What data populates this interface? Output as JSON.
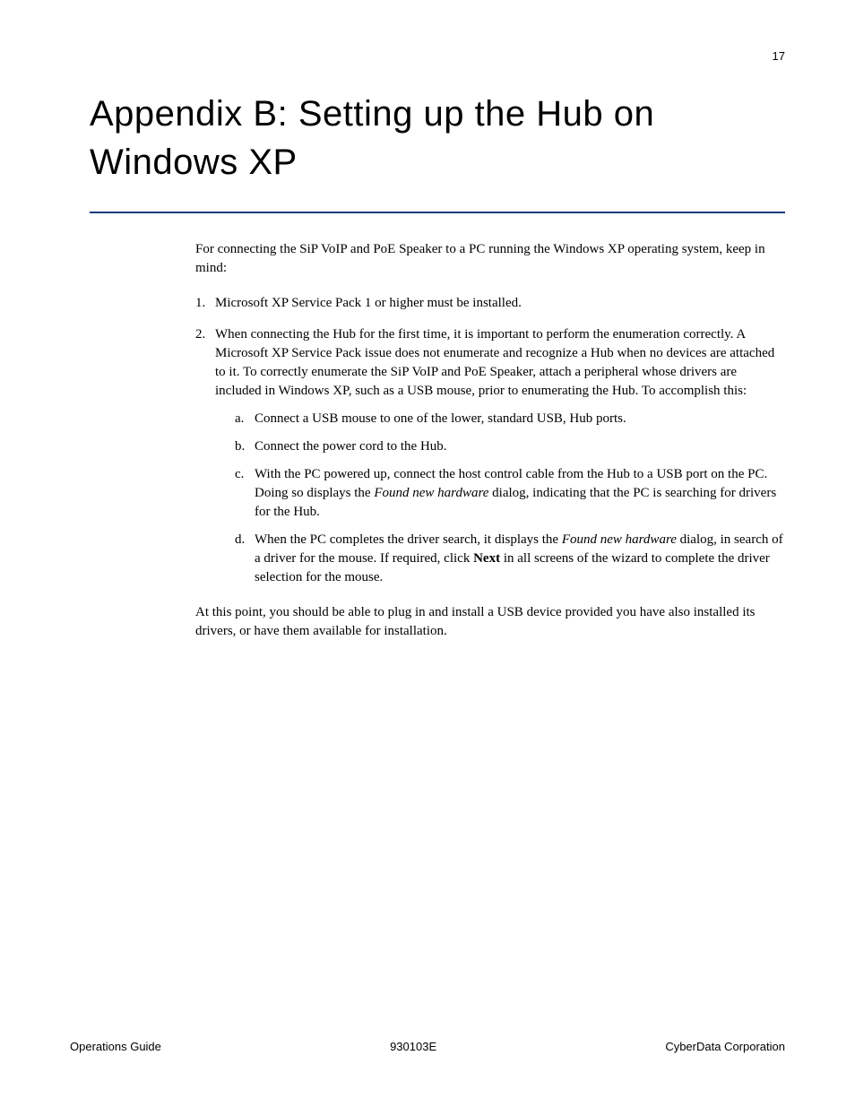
{
  "page_number": "17",
  "title": "Appendix B: Setting up the Hub on Windows XP",
  "intro": "For connecting the SiP VoIP and PoE Speaker to a PC running the Windows XP operating system, keep in mind:",
  "item1_marker": "1.",
  "item1_text": "Microsoft XP Service Pack 1 or higher must be installed.",
  "item2_marker": "2.",
  "item2_text": "When connecting the Hub for the first time, it is important to perform the enumeration correctly. A Microsoft XP Service Pack issue does not enumerate and recognize a Hub when no devices are attached to it. To correctly enumerate the SiP VoIP and PoE Speaker, attach a peripheral whose drivers are included in Windows XP, such as a USB mouse, prior to enumerating the Hub. To accomplish this:",
  "sub_a_marker": "a.",
  "sub_a_text": "Connect a USB mouse to one of the lower, standard USB, Hub ports.",
  "sub_b_marker": "b.",
  "sub_b_text": "Connect the power cord to the Hub.",
  "sub_c_marker": "c.",
  "sub_c_pre": "With the PC powered up, connect the host control cable from the Hub to a USB port on the PC. Doing so displays the ",
  "sub_c_italic": "Found new hardware",
  "sub_c_post": " dialog, indicating that the PC is searching for drivers for the Hub.",
  "sub_d_marker": "d.",
  "sub_d_pre": "When the PC completes the driver search, it displays the ",
  "sub_d_italic": "Found new hardware",
  "sub_d_mid": " dialog, in search of a driver for the mouse. If required, click ",
  "sub_d_bold": "Next",
  "sub_d_post": " in all screens of the wizard to complete the driver selection for the mouse.",
  "closing": "At this point, you should be able to plug in and install a USB device provided you have also installed its drivers, or have them available for installation.",
  "footer_left": "Operations Guide",
  "footer_center": "930103E",
  "footer_right": "CyberData Corporation"
}
